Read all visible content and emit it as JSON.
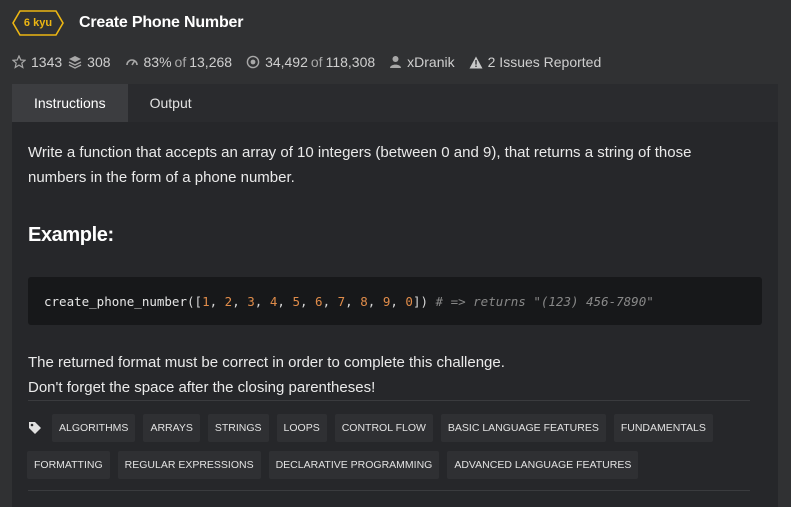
{
  "header": {
    "rank": "6 kyu",
    "title": "Create Phone Number"
  },
  "stats": {
    "stars": "1343",
    "collections": "308",
    "satisfaction_percent": "83%",
    "satisfaction_of": "of",
    "satisfaction_votes": "13,268",
    "completed": "34,492",
    "completed_of": "of",
    "attempted": "118,308",
    "author": "xDranik",
    "issues": "2 Issues Reported"
  },
  "tabs": [
    {
      "label": "Instructions",
      "active": true
    },
    {
      "label": "Output",
      "active": false
    }
  ],
  "instructions": {
    "description": "Write a function that accepts an array of 10 integers (between 0 and 9), that returns a string of those numbers in the form of a phone number.",
    "example_heading": "Example:",
    "code": {
      "function_name": "create_phone_number",
      "numbers": [
        "1",
        "2",
        "3",
        "4",
        "5",
        "6",
        "7",
        "8",
        "9",
        "0"
      ],
      "comment": "# => returns \"(123) 456-7890\""
    },
    "note_line1": "The returned format must be correct in order to complete this challenge.",
    "note_line2": "Don't forget the space after the closing parentheses!"
  },
  "tags": [
    "ALGORITHMS",
    "ARRAYS",
    "STRINGS",
    "LOOPS",
    "CONTROL FLOW",
    "BASIC LANGUAGE FEATURES",
    "FUNDAMENTALS",
    "FORMATTING",
    "REGULAR EXPRESSIONS",
    "DECLARATIVE PROGRAMMING",
    "ADVANCED LANGUAGE FEATURES"
  ],
  "colors": {
    "background": "#303133",
    "panel": "#26272a",
    "kyu_accent": "#ecb613",
    "code_background": "#17181a",
    "number_color": "#e08c4a",
    "comment_color": "#888888"
  },
  "icons": [
    "star-icon",
    "collection-icon",
    "satisfaction-icon",
    "completed-icon",
    "user-icon",
    "warning-icon",
    "tag-icon"
  ]
}
